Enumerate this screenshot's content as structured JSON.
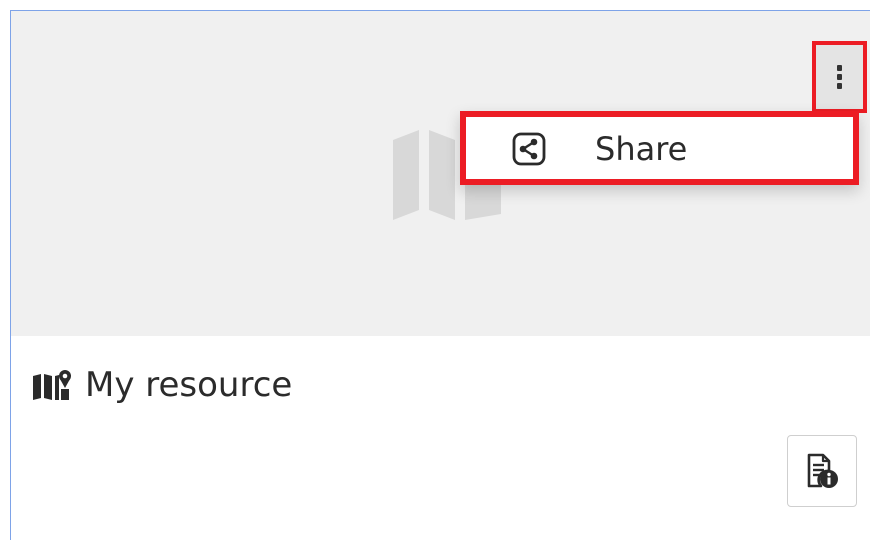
{
  "menu": {
    "items": [
      {
        "label": "Share",
        "icon": "share-icon"
      }
    ]
  },
  "card": {
    "title": "My resource",
    "title_icon": "map-marker-icon",
    "thumbnail_icon": "map-icon",
    "more_icon": "vertical-dots-icon",
    "details_icon": "document-info-icon"
  },
  "colors": {
    "highlight": "#ec1c24",
    "card_border": "#7ea3e8",
    "thumbnail_bg": "#f0f0f0"
  }
}
